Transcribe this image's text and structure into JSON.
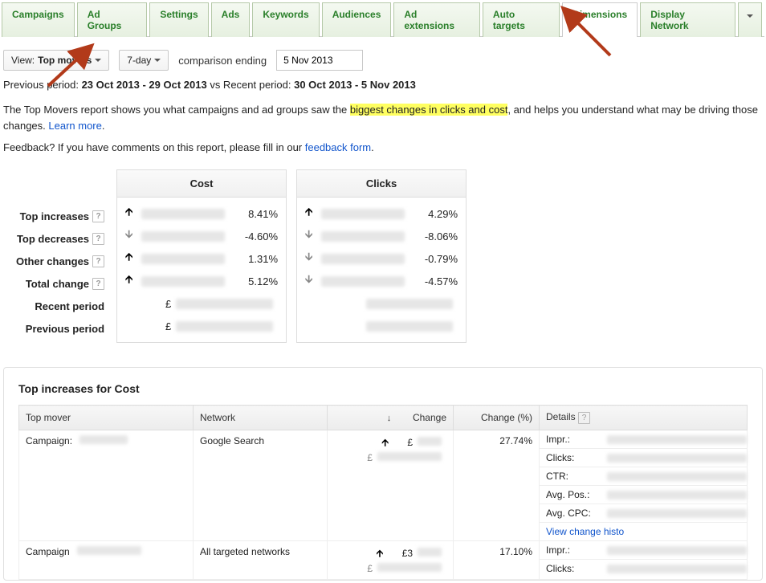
{
  "tabs": [
    "Campaigns",
    "Ad Groups",
    "Settings",
    "Ads",
    "Keywords",
    "Audiences",
    "Ad extensions",
    "Auto targets",
    "Dimensions",
    "Display Network"
  ],
  "activeTab": "Dimensions",
  "view": {
    "label": "View:",
    "value": "Top movers"
  },
  "range": {
    "value": "7-day"
  },
  "compLabel": "comparison ending",
  "dateEnd": "5 Nov 2013",
  "periods": {
    "prefix": "Previous period:",
    "prev": "23 Oct 2013 - 29 Oct 2013",
    "vs": "vs Recent period:",
    "recent": "30 Oct 2013 - 5 Nov 2013"
  },
  "desc": {
    "a": "The Top Movers report shows you what campaigns and ad groups saw the ",
    "hl": "biggest changes in clicks and cost",
    "b": ", and helps you understand what may be driving those changes. ",
    "link": "Learn more"
  },
  "fb": {
    "a": "Feedback? If you have comments on this report, please fill in our ",
    "link": "feedback form"
  },
  "rows": [
    "Top increases",
    "Top decreases",
    "Other changes",
    "Total change",
    "Recent period",
    "Previous period"
  ],
  "cols": {
    "cost": {
      "title": "Cost",
      "vals": [
        {
          "dir": "up",
          "pct": "8.41%"
        },
        {
          "dir": "down",
          "pct": "-4.60%"
        },
        {
          "dir": "up",
          "pct": "1.31%"
        },
        {
          "dir": "up",
          "pct": "5.12%"
        },
        {
          "prefix": "£"
        },
        {
          "prefix": "£"
        }
      ]
    },
    "clicks": {
      "title": "Clicks",
      "vals": [
        {
          "dir": "up",
          "pct": "4.29%"
        },
        {
          "dir": "down",
          "pct": "-8.06%"
        },
        {
          "dir": "down",
          "pct": "-0.79%"
        },
        {
          "dir": "down",
          "pct": "-4.57%"
        },
        {},
        {}
      ]
    }
  },
  "panel": {
    "title": "Top increases for Cost",
    "headers": {
      "mover": "Top mover",
      "network": "Network",
      "change": "Change",
      "changePct": "Change (%)",
      "details": "Details"
    },
    "rows": [
      {
        "mover": "Campaign:",
        "network": "Google Search",
        "dir": "up",
        "amt": "£",
        "pct": "27.74%",
        "details": [
          {
            "l": "Impr.:"
          },
          {
            "l": "Clicks:"
          },
          {
            "l": "CTR:"
          },
          {
            "l": "Avg. Pos.:"
          },
          {
            "l": "Avg. CPC:"
          }
        ],
        "link": "View change histo"
      },
      {
        "mover": "Campaign",
        "network": "All targeted networks",
        "dir": "up",
        "amt": "£3",
        "pct": "17.10%",
        "details": [
          {
            "l": "Impr.:"
          },
          {
            "l": "Clicks:"
          }
        ]
      }
    ]
  }
}
